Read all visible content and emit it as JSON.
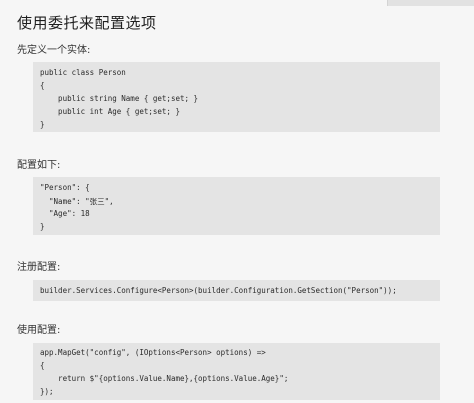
{
  "title": "使用委托来配置选项",
  "section1": {
    "label": "先定义一个实体:",
    "code": [
      "public class Person",
      "{",
      "    public string Name { get;set; }",
      "    public int Age { get;set; }",
      "}"
    ]
  },
  "section2": {
    "label": "配置如下:",
    "code": [
      "\"Person\": {",
      "  \"Name\": \"张三\",",
      "  \"Age\": 18",
      "}"
    ]
  },
  "section3": {
    "label": "注册配置:",
    "code": [
      "builder.Services.Configure<Person>(builder.Configuration.GetSection(\"Person\"));"
    ]
  },
  "section4": {
    "label": "使用配置:",
    "code": [
      "app.MapGet(\"config\", (IOptions<Person> options) =>",
      "{",
      "    return $\"{options.Value.Name},{options.Value.Age}\";",
      "});"
    ]
  }
}
